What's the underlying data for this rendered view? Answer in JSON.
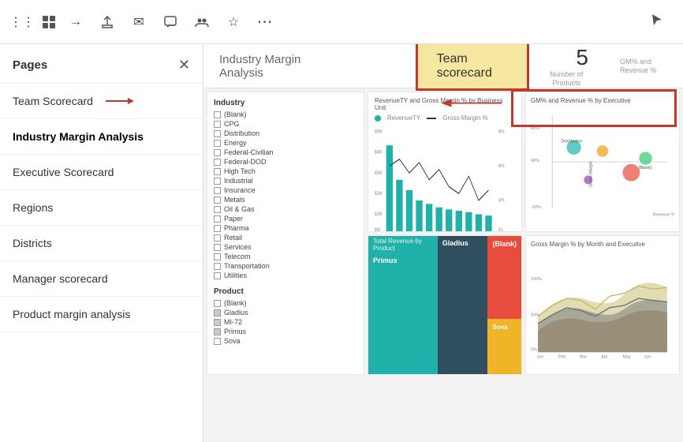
{
  "toolbar": {
    "icons": [
      {
        "name": "grid-icon",
        "symbol": "⊞"
      },
      {
        "name": "return-icon",
        "symbol": "→"
      },
      {
        "name": "share-icon",
        "symbol": "↑"
      },
      {
        "name": "mail-icon",
        "symbol": "✉"
      },
      {
        "name": "comment-icon",
        "symbol": "💬"
      },
      {
        "name": "teams-icon",
        "symbol": "👥"
      },
      {
        "name": "bookmark-icon",
        "symbol": "☆"
      },
      {
        "name": "more-icon",
        "symbol": "···"
      }
    ]
  },
  "sidebar": {
    "title": "Pages",
    "close_label": "✕",
    "items": [
      {
        "label": "Team Scorecard",
        "active": false,
        "bold": false,
        "has_arrow": true
      },
      {
        "label": "Industry Margin Analysis",
        "active": true,
        "bold": true,
        "has_arrow": false
      },
      {
        "label": "Executive Scorecard",
        "active": false,
        "bold": false,
        "has_arrow": false
      },
      {
        "label": "Regions",
        "active": false,
        "bold": false,
        "has_arrow": false
      },
      {
        "label": "Districts",
        "active": false,
        "bold": false,
        "has_arrow": false
      },
      {
        "label": "Manager scorecard",
        "active": false,
        "bold": false,
        "has_arrow": false
      },
      {
        "label": "Product margin analysis",
        "active": false,
        "bold": false,
        "has_arrow": false
      }
    ]
  },
  "page": {
    "title": "Industry Margin Analysis",
    "team_scorecard_label": "Team scorecard",
    "number": "5",
    "number_label": "Number of Products"
  },
  "filters": {
    "industry_title": "Industry",
    "industry_items": [
      "(Blank)",
      "CPG",
      "Distribution",
      "Energy",
      "Federal-Civilian",
      "Federal-DOD",
      "High Tech",
      "Industrial",
      "Insurance",
      "Metals",
      "Oil & Gas",
      "Paper",
      "Pharma",
      "Retail",
      "Services",
      "Telecom",
      "Transportation",
      "Utilities"
    ],
    "product_title": "Product",
    "product_items": [
      "(Blank)",
      "Gladius",
      "MI-72",
      "Primus",
      "Sova"
    ]
  },
  "charts": {
    "revenue_gross_label": "RevenueTY and Gross Margin % by Business Unit",
    "revenue_ty_label": "RevenueTY",
    "gross_margin_label": "Gross Margin %",
    "treemap_label": "Total Revenue by Product",
    "treemap_segments": [
      "Primus",
      "Gladius",
      "(Blank)"
    ],
    "scatter_label": "GM% and Revenue % by Executive",
    "area_label": "Gross Margin % by Month and Executive"
  },
  "colors": {
    "active_item_color": "#000",
    "accent_teal": "#20b2aa",
    "accent_dark": "#2f4f5f",
    "accent_red": "#e74c3c",
    "accent_yellow": "#f0b429",
    "red_border": "#c0392b",
    "bar_color": "#20b2aa",
    "line_color": "#333"
  }
}
